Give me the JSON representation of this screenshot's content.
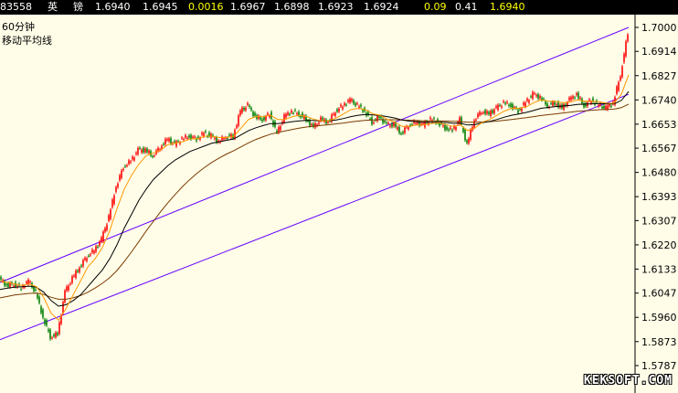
{
  "header": {
    "code": "83558",
    "name1": "英",
    "name2": "镑",
    "price": "1.6940",
    "price2": "1.6945",
    "change": "0.0016",
    "high": "1.6967",
    "low": "1.6898",
    "v1": "1.6923",
    "v2": "1.6924",
    "pct": "0.09",
    "v3": "0.41",
    "last": "1.6940"
  },
  "labels": {
    "period": "60分钟",
    "indicator": "移动平均线"
  },
  "watermark": "KEKSOFT.COM",
  "colors": {
    "up": "#ff0000",
    "down": "#008000",
    "channel": "#6600ff",
    "ma_short": "#ff9900",
    "ma_mid": "#000000",
    "ma_long": "#7a3a00"
  },
  "chart_data": {
    "type": "line",
    "y_ticks": [
      "1.7000",
      "1.6914",
      "1.6827",
      "1.6740",
      "1.6653",
      "1.6567",
      "1.6480",
      "1.6393",
      "1.6307",
      "1.6220",
      "1.6133",
      "1.6047",
      "1.5960",
      "1.5873",
      "1.5787"
    ],
    "ylim": [
      1.5787,
      1.7
    ],
    "x": [
      0,
      8,
      16,
      24,
      32,
      40,
      48,
      56,
      64,
      72,
      80,
      88,
      96,
      104,
      112,
      120,
      128,
      136,
      144,
      152,
      160,
      168,
      176,
      184,
      192,
      200,
      208,
      216,
      224,
      232,
      240,
      248,
      256,
      264,
      272,
      280,
      288,
      296,
      304,
      312,
      320,
      328,
      336,
      344,
      352,
      360,
      368,
      376,
      384,
      392,
      400,
      408,
      416,
      424,
      432,
      440,
      448,
      456,
      464,
      472,
      480,
      488,
      496,
      504,
      512,
      520,
      528,
      536,
      544,
      552,
      560,
      568,
      576,
      584,
      592,
      600,
      608,
      616,
      624,
      632,
      640,
      648,
      656,
      664,
      672,
      680,
      688
    ],
    "close": [
      1.61,
      1.6075,
      1.608,
      1.6065,
      1.609,
      1.605,
      1.596,
      1.589,
      1.59,
      1.605,
      1.61,
      1.614,
      1.618,
      1.62,
      1.624,
      1.632,
      1.643,
      1.65,
      1.652,
      1.656,
      1.656,
      1.654,
      1.657,
      1.66,
      1.658,
      1.66,
      1.661,
      1.66,
      1.662,
      1.661,
      1.659,
      1.661,
      1.661,
      1.67,
      1.672,
      1.668,
      1.667,
      1.669,
      1.662,
      1.668,
      1.67,
      1.669,
      1.667,
      1.664,
      1.667,
      1.666,
      1.67,
      1.672,
      1.674,
      1.672,
      1.67,
      1.666,
      1.668,
      1.665,
      1.665,
      1.662,
      1.665,
      1.666,
      1.665,
      1.667,
      1.666,
      1.664,
      1.663,
      1.667,
      1.658,
      1.667,
      1.67,
      1.669,
      1.671,
      1.673,
      1.672,
      1.67,
      1.673,
      1.676,
      1.675,
      1.672,
      1.673,
      1.671,
      1.674,
      1.676,
      1.672,
      1.674,
      1.672,
      1.671,
      1.673,
      1.683,
      1.698
    ],
    "ma_short": [
      1.609,
      1.6085,
      1.608,
      1.6075,
      1.608,
      1.607,
      1.603,
      1.5975,
      1.595,
      1.599,
      1.604,
      1.609,
      1.614,
      1.617,
      1.621,
      1.627,
      1.635,
      1.642,
      1.647,
      1.651,
      1.654,
      1.655,
      1.656,
      1.658,
      1.6585,
      1.659,
      1.66,
      1.66,
      1.661,
      1.661,
      1.6605,
      1.6605,
      1.661,
      1.664,
      1.667,
      1.668,
      1.668,
      1.6685,
      1.667,
      1.667,
      1.668,
      1.6685,
      1.668,
      1.667,
      1.6665,
      1.6665,
      1.6675,
      1.669,
      1.6705,
      1.671,
      1.6705,
      1.669,
      1.6685,
      1.667,
      1.666,
      1.6645,
      1.6645,
      1.665,
      1.665,
      1.6655,
      1.6658,
      1.6652,
      1.6645,
      1.665,
      1.663,
      1.664,
      1.666,
      1.667,
      1.6685,
      1.67,
      1.671,
      1.671,
      1.6715,
      1.673,
      1.674,
      1.6735,
      1.6735,
      1.673,
      1.6732,
      1.674,
      1.6735,
      1.6735,
      1.6733,
      1.6728,
      1.6728,
      1.676,
      1.683
    ],
    "ma_mid": [
      1.606,
      1.6065,
      1.6068,
      1.607,
      1.6072,
      1.6068,
      1.605,
      1.602,
      1.6,
      1.6005,
      1.602,
      1.604,
      1.607,
      1.61,
      1.613,
      1.617,
      1.622,
      1.628,
      1.633,
      1.638,
      1.642,
      1.6455,
      1.648,
      1.6505,
      1.6525,
      1.654,
      1.6555,
      1.6565,
      1.6575,
      1.6585,
      1.659,
      1.6595,
      1.66,
      1.6615,
      1.663,
      1.664,
      1.6648,
      1.6655,
      1.6655,
      1.6658,
      1.6662,
      1.6665,
      1.6667,
      1.6666,
      1.6665,
      1.6665,
      1.6668,
      1.6673,
      1.668,
      1.6685,
      1.6688,
      1.6686,
      1.6684,
      1.668,
      1.6675,
      1.6668,
      1.6664,
      1.6662,
      1.666,
      1.666,
      1.666,
      1.6659,
      1.6656,
      1.6656,
      1.665,
      1.6652,
      1.6658,
      1.6663,
      1.667,
      1.6678,
      1.6685,
      1.669,
      1.6695,
      1.6702,
      1.671,
      1.6713,
      1.6716,
      1.6718,
      1.672,
      1.6724,
      1.6725,
      1.6726,
      1.6727,
      1.6726,
      1.6726,
      1.6738,
      1.677
    ],
    "ma_long": [
      1.603,
      1.6035,
      1.604,
      1.6043,
      1.6046,
      1.6047,
      1.6042,
      1.6032,
      1.6025,
      1.6025,
      1.603,
      1.6038,
      1.605,
      1.6065,
      1.6082,
      1.6102,
      1.6128,
      1.616,
      1.6195,
      1.6232,
      1.627,
      1.6305,
      1.634,
      1.6372,
      1.6402,
      1.643,
      1.6455,
      1.6478,
      1.6498,
      1.6516,
      1.6532,
      1.6546,
      1.6558,
      1.6572,
      1.6586,
      1.6598,
      1.6608,
      1.6617,
      1.6623,
      1.6629,
      1.6634,
      1.6639,
      1.6643,
      1.6646,
      1.6649,
      1.6651,
      1.6654,
      1.6657,
      1.6661,
      1.6664,
      1.6667,
      1.6668,
      1.6669,
      1.6669,
      1.6669,
      1.6668,
      1.6667,
      1.6666,
      1.6665,
      1.6665,
      1.6665,
      1.6664,
      1.6663,
      1.6662,
      1.666,
      1.666,
      1.6661,
      1.6662,
      1.6664,
      1.6667,
      1.667,
      1.6673,
      1.6676,
      1.668,
      1.6684,
      1.6687,
      1.669,
      1.6693,
      1.6696,
      1.6699,
      1.6701,
      1.6703,
      1.6705,
      1.6706,
      1.6707,
      1.6712,
      1.6725
    ],
    "channel_upper": [
      [
        0,
        1.6085
      ],
      [
        688,
        1.7
      ]
    ],
    "channel_lower": [
      [
        0,
        1.588
      ],
      [
        688,
        1.676
      ]
    ],
    "grid": false
  }
}
